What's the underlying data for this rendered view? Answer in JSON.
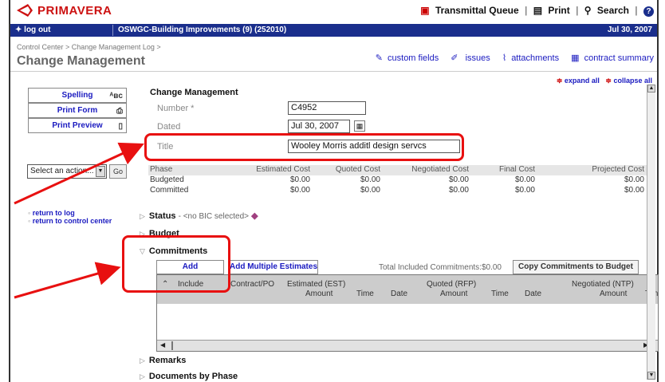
{
  "app": {
    "logo": "PRIMAVERA",
    "transmittal": "Transmittal Queue",
    "print": "Print",
    "search": "Search"
  },
  "nav": {
    "logout": "log out",
    "project": "OSWGC-Building Improvements (9) (252010)",
    "date": "Jul 30, 2007"
  },
  "breadcrumb": "Control Center > Change Management Log >",
  "page_title": "Change Management",
  "top_links": {
    "custom_fields": "custom fields",
    "issues": "issues",
    "attachments": "attachments",
    "contract_summary": "contract summary"
  },
  "expand": {
    "expand_all": "expand all",
    "collapse_all": "collapse all"
  },
  "left": {
    "spelling": "Spelling",
    "print_form": "Print Form",
    "print_preview": "Print Preview",
    "action_select": "Select an action...",
    "go": "Go",
    "return_log": "return to log",
    "return_control": "return to control center"
  },
  "form": {
    "heading": "Change Management",
    "number_label": "Number *",
    "number_value": "C4952",
    "dated_label": "Dated",
    "dated_value": "Jul 30, 2007",
    "title_label": "Title",
    "title_value": "Wooley Morris additl design servcs"
  },
  "phase_table": {
    "headers": [
      "Phase",
      "Estimated Cost",
      "Quoted Cost",
      "Negotiated Cost",
      "Final Cost",
      "Projected Cost"
    ],
    "rows": [
      [
        "Budgeted",
        "$0.00",
        "$0.00",
        "$0.00",
        "$0.00",
        "$0.00"
      ],
      [
        "Committed",
        "$0.00",
        "$0.00",
        "$0.00",
        "$0.00",
        "$0.00"
      ]
    ]
  },
  "sections": {
    "status": "Status",
    "status_sub": "- <no BIC selected>",
    "budget": "Budget",
    "commitments": "Commitments",
    "remarks": "Remarks",
    "documents": "Documents by Phase"
  },
  "commitments": {
    "add": "Add",
    "add_multiple": "Add Multiple Estimates",
    "total_label": "Total Included Commitments:$0.00",
    "copy": "Copy Commitments to Budget",
    "columns": {
      "include": "Include",
      "contract": "Contract/PO",
      "est": "Estimated (EST)",
      "amount": "Amount",
      "time": "Time",
      "date": "Date",
      "quoted": "Quoted (RFP)",
      "negotiated": "Negotiated (NTP)",
      "tim": "Tim"
    }
  },
  "colors": {
    "nav_bar": "#1a2e8c",
    "highlight": "#e81010",
    "link": "#1a1ac0"
  }
}
